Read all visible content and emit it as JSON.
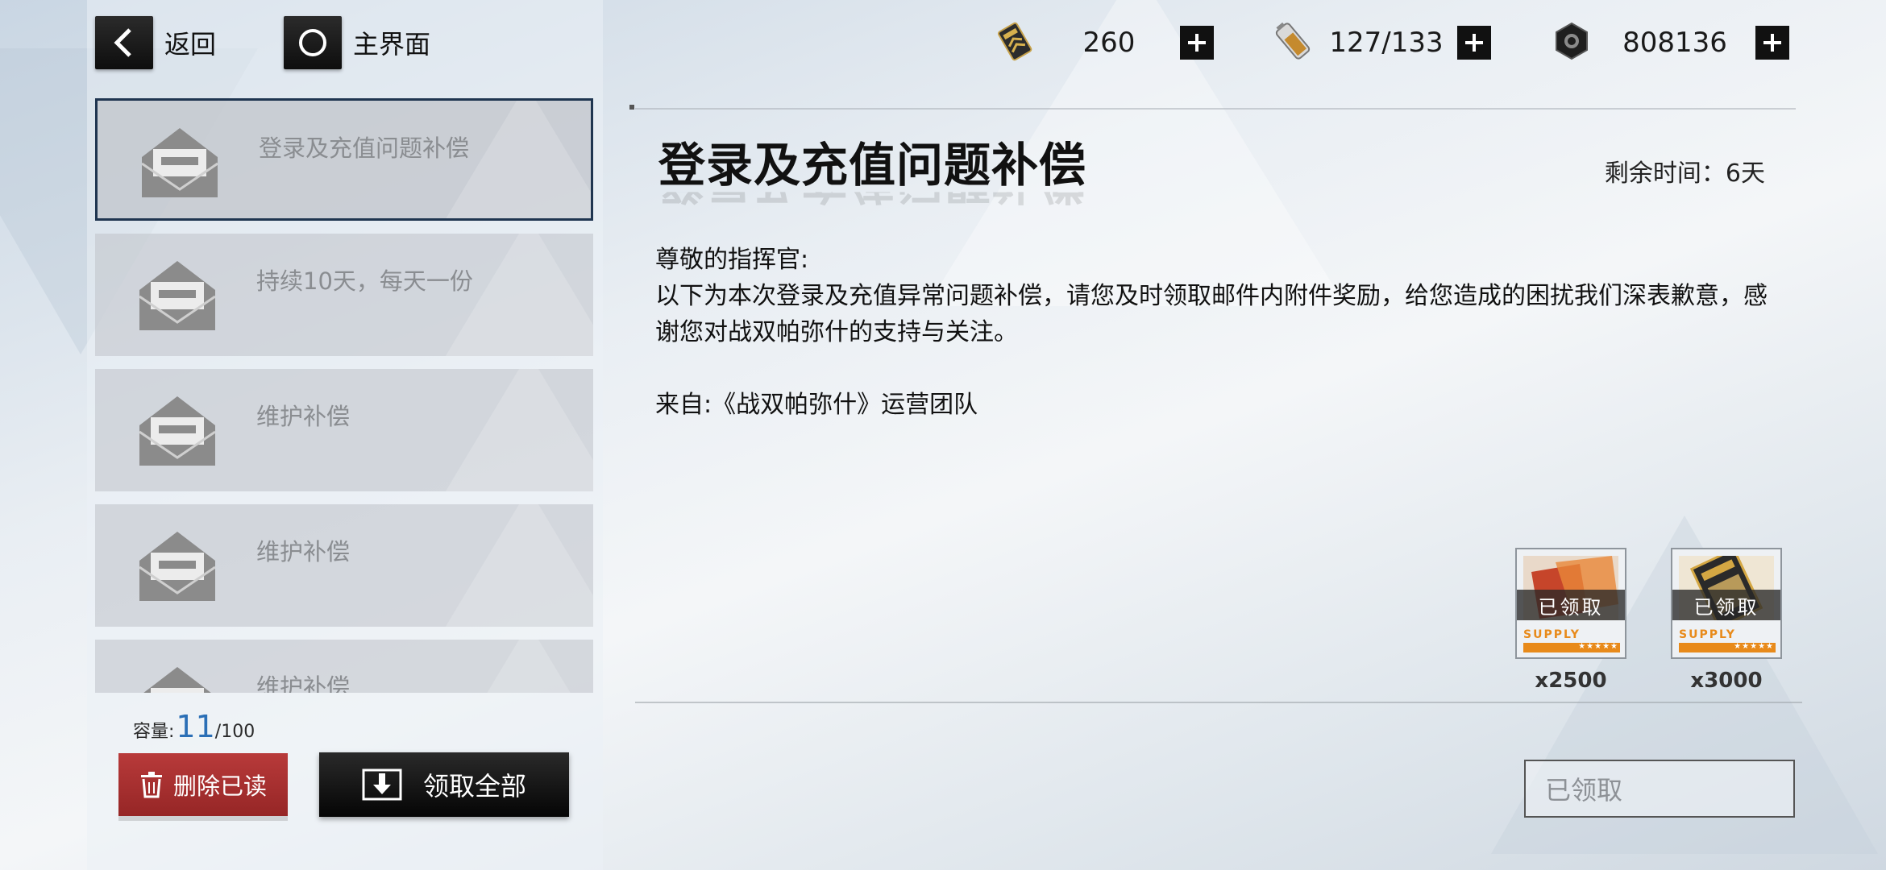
{
  "nav": {
    "back_label": "返回",
    "home_label": "主界面"
  },
  "resources": [
    {
      "icon": "stamina-card-icon",
      "value": "260"
    },
    {
      "icon": "battery-icon",
      "value": "127/133"
    },
    {
      "icon": "hex-nut-coin-icon",
      "value": "808136"
    }
  ],
  "mail_list": {
    "items": [
      {
        "title": "登录及充值问题补偿",
        "selected": true
      },
      {
        "title": "持续10天，每天一份",
        "selected": false
      },
      {
        "title": "维护补偿",
        "selected": false
      },
      {
        "title": "维护补偿",
        "selected": false
      },
      {
        "title": "维护补偿",
        "selected": false
      }
    ]
  },
  "capacity": {
    "label": "容量:",
    "value": "11",
    "max": "/100"
  },
  "buttons": {
    "delete_read": "删除已读",
    "claim_all": "领取全部",
    "claimed": "已领取"
  },
  "mail": {
    "title": "登录及充值问题补偿",
    "remaining_time": "剩余时间：6天",
    "greeting": "尊敬的指挥官:",
    "body": "以下为本次登录及充值异常问题补偿，请您及时领取邮件内附件奖励，给您造成的困扰我们深表歉意，感谢您对战双帕弥什的支持与关注。",
    "from": "来自:《战双帕弥什》运营团队"
  },
  "attachments": [
    {
      "badge": "已领取",
      "supply": "SUPPLY",
      "stars": "★★★★★",
      "quantity": "x2500"
    },
    {
      "badge": "已领取",
      "supply": "SUPPLY",
      "stars": "★★★★★",
      "quantity": "x3000"
    }
  ]
}
